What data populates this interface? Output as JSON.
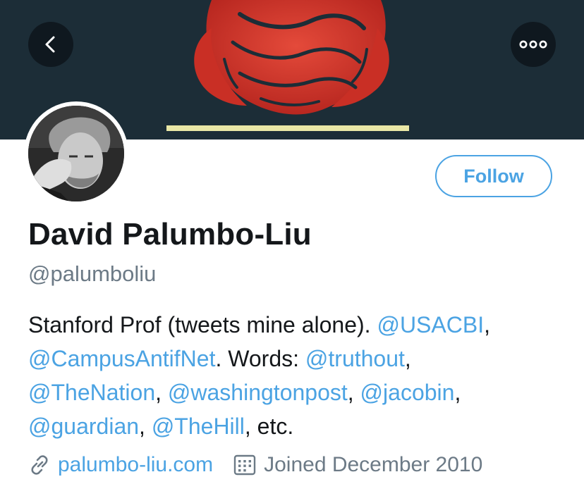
{
  "header": {
    "back_icon": "chevron-left-icon",
    "more_icon": "more-horizontal-icon"
  },
  "colors": {
    "banner_bg": "#1c2d37",
    "rose": "#d8362d",
    "accent": "#4ba3e3",
    "muted": "#6c7a86",
    "text": "#14171a"
  },
  "profile": {
    "follow_label": "Follow",
    "display_name": "David Palumbo-Liu",
    "handle": "@palumboliu",
    "bio": {
      "l1_text": "Stanford Prof (tweets mine alone). ",
      "l1_m1": "@USACBI",
      "l1_sep": ",",
      "l2_m1": "@CampusAntifNet",
      "l2_text": ". Words: ",
      "l2_m2": "@truthout",
      "l2_sep": ",",
      "l3_m1": "@TheNation",
      "l3_sep1": ", ",
      "l3_m2": "@washingtonpost",
      "l3_sep2": ", ",
      "l3_m3": "@jacobin",
      "l3_sep3": ",",
      "l4_m1": "@guardian",
      "l4_sep1": ", ",
      "l4_m2": "@TheHill",
      "l4_text": ", etc."
    },
    "website": "palumbo-liu.com",
    "joined": "Joined December 2010",
    "website_icon": "link-icon",
    "joined_icon": "calendar-icon"
  }
}
